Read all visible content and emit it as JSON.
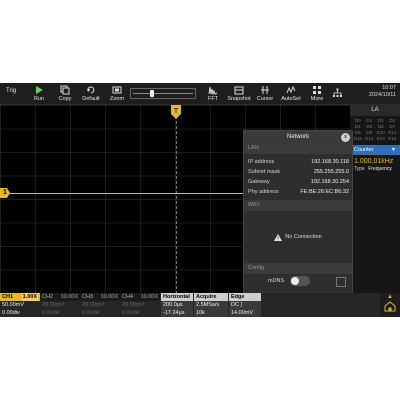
{
  "toolbar": {
    "trig_label": "Trig",
    "run_label": "Run",
    "copy_label": "Copy",
    "default_label": "Default",
    "zoom_label": "Zoom",
    "fft_label": "FFT",
    "snapshot_label": "Snapshot",
    "cursor_label": "Cursor",
    "autoset_label": "AutoSet",
    "more_label": "More",
    "time": "10:07",
    "date": "2024/10/11"
  },
  "trigger_marker": "T",
  "channel_marker": "1",
  "right_panel": {
    "la_title": "LA",
    "la_channels": [
      "D0",
      "D1",
      "D2",
      "D3",
      "D4",
      "D5",
      "D6",
      "D7",
      "D8",
      "D9",
      "D10",
      "D11",
      "D12",
      "D13",
      "D14",
      "D15"
    ],
    "counter_label": "Counter",
    "counter_value": "1.000,01kHz",
    "type_label": "Type",
    "type_value": "Frequency"
  },
  "network_dialog": {
    "title": "Network",
    "lan_header": "LAN",
    "ip_label": "IP address",
    "ip_value": "192.168.30.118",
    "mask_label": "Subnet mask",
    "mask_value": "255.255.255.0",
    "gateway_label": "Gateway",
    "gateway_value": "192.168.30.254",
    "phy_label": "Phy address",
    "phy_value": "FE:BE:26:EC:B6:32",
    "wifi_header": "WiFi",
    "wifi_status": "No Connection",
    "config_header": "Config",
    "mdns_label": "mDNS",
    "mdns_enabled": false
  },
  "status_bar": {
    "ch1": {
      "name": "CH1",
      "tag": "1.00X",
      "scale": "50.00mV",
      "offset": "0.00div"
    },
    "ch2": {
      "name": "CH2",
      "tag": "10.00X",
      "scale": "20.00mV",
      "offset": "0.00div"
    },
    "ch3": {
      "name": "CH3",
      "tag": "10.00X",
      "scale": "20.00mV",
      "offset": "0.00div"
    },
    "ch4": {
      "name": "CH4",
      "tag": "10.00X",
      "scale": "20.00mV",
      "offset": "0.00div"
    },
    "horizontal": {
      "name": "Horizontal",
      "v1": "200.0µs",
      "v2": "-17.24µs"
    },
    "acquire": {
      "name": "Acquire",
      "v1": "2.5MSa/s",
      "v2": "10k"
    },
    "edge": {
      "name": "Edge",
      "v1": "DC ∫",
      "v2": "14.00mV"
    }
  },
  "colors": {
    "ch1": "#e3b92b",
    "accent": "#2d6fb8"
  }
}
